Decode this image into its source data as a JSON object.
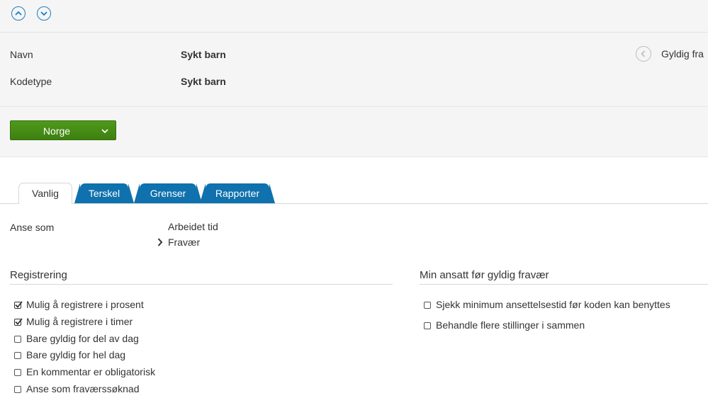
{
  "toolbar": {
    "up_icon": "chevron-up-circle-icon",
    "down_icon": "chevron-down-circle-icon"
  },
  "info": {
    "name_label": "Navn",
    "name_value": "Sykt barn",
    "codetype_label": "Kodetype",
    "codetype_value": "Sykt barn",
    "valid_from_text": "Gyldig fra"
  },
  "country": {
    "label": "Norge"
  },
  "tabs": [
    {
      "label": "Vanlig",
      "active": true
    },
    {
      "label": "Terskel",
      "active": false
    },
    {
      "label": "Grenser",
      "active": false
    },
    {
      "label": "Rapporter",
      "active": false
    }
  ],
  "treat_as": {
    "label": "Anse som",
    "options": [
      {
        "label": "Arbeidet tid",
        "selected": false
      },
      {
        "label": "Fravær",
        "selected": true
      }
    ]
  },
  "registration": {
    "title": "Registrering",
    "items": [
      {
        "label": "Mulig å registrere i prosent",
        "checked": true
      },
      {
        "label": "Mulig å registrere i timer",
        "checked": true
      },
      {
        "label": "Bare gyldig for del av dag",
        "checked": false
      },
      {
        "label": "Bare gyldig for hel dag",
        "checked": false
      },
      {
        "label": "En kommentar er obligatorisk",
        "checked": false
      },
      {
        "label": "Anse som fraværssøknad",
        "checked": false
      }
    ]
  },
  "min_employment": {
    "title": "Min ansatt før gyldig fravær",
    "items": [
      {
        "label": "Sjekk minimum ansettelsestid før koden kan benyttes",
        "checked": false
      },
      {
        "label": "Behandle flere stillinger i sammen",
        "checked": false
      }
    ]
  },
  "colors": {
    "accent_blue": "#0f71ad",
    "green_button": "#4f9a1b"
  }
}
